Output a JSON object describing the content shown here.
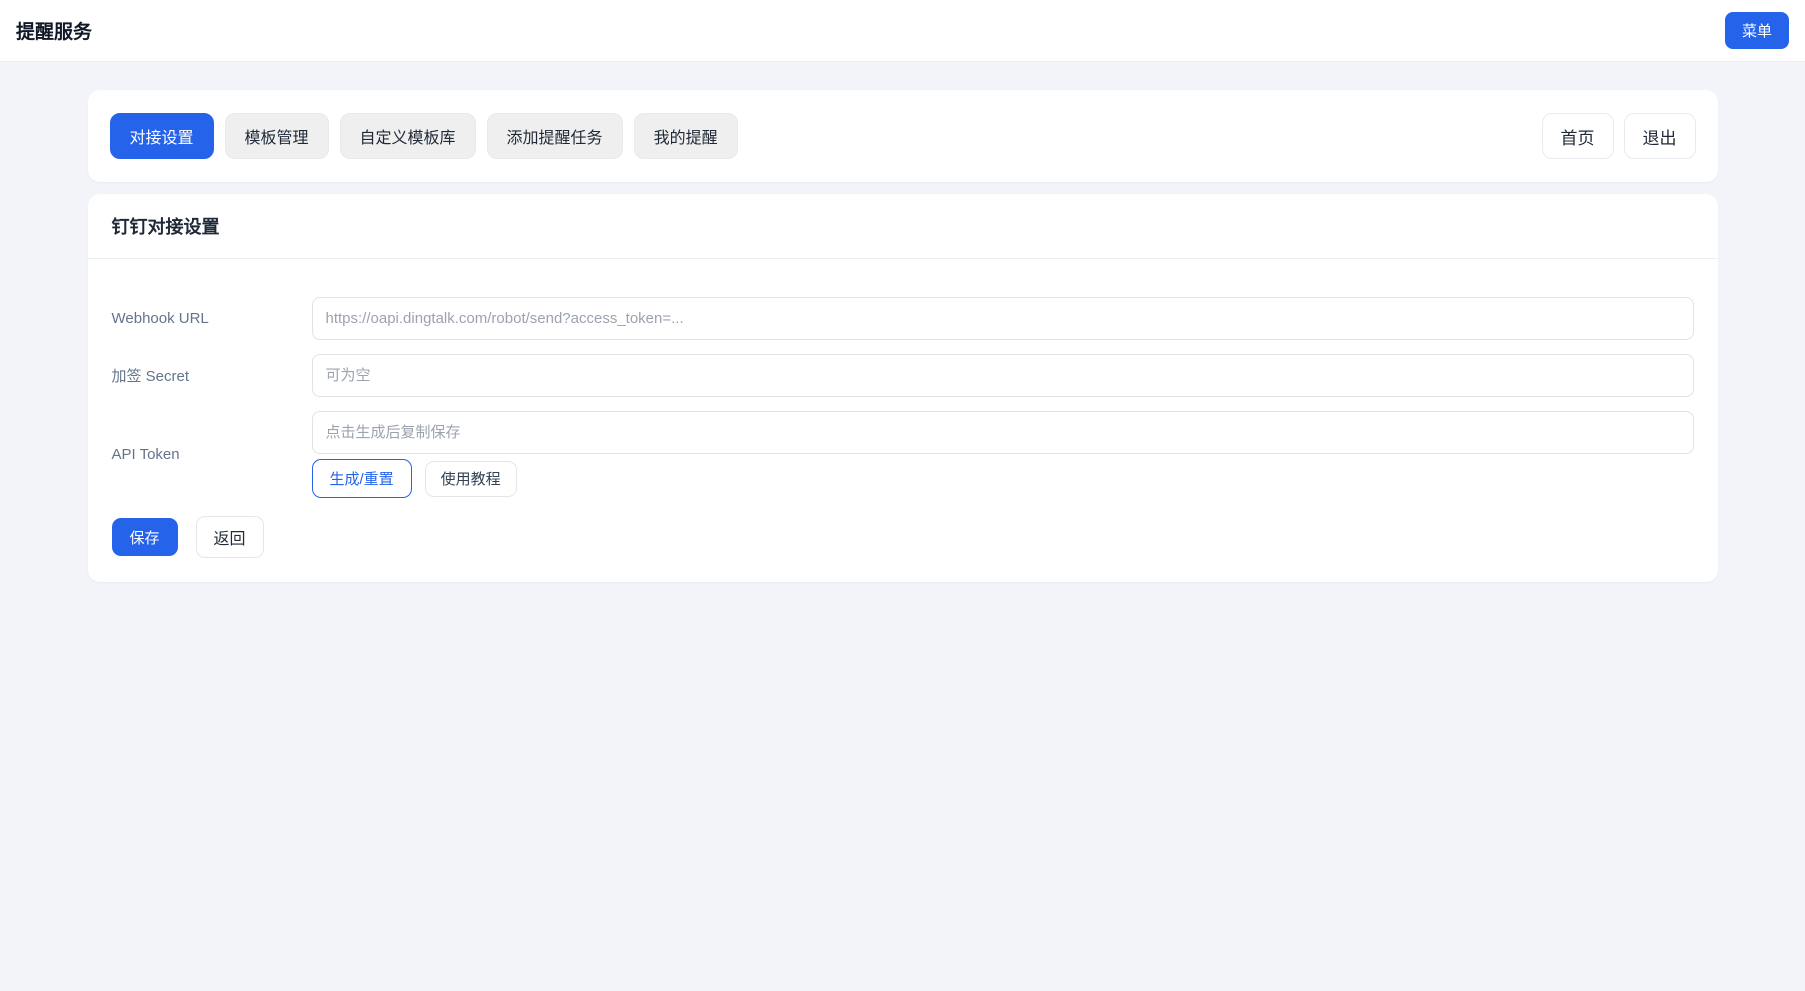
{
  "header": {
    "title": "提醒服务",
    "menu_button": "菜单"
  },
  "nav": {
    "tabs": [
      {
        "label": "对接设置",
        "active": true
      },
      {
        "label": "模板管理",
        "active": false
      },
      {
        "label": "自定义模板库",
        "active": false
      },
      {
        "label": "添加提醒任务",
        "active": false
      },
      {
        "label": "我的提醒",
        "active": false
      }
    ],
    "home_button": "首页",
    "logout_button": "退出"
  },
  "settings_card": {
    "title": "钉钉对接设置",
    "fields": {
      "webhook": {
        "label": "Webhook URL",
        "value": "",
        "placeholder": "https://oapi.dingtalk.com/robot/send?access_token=..."
      },
      "secret": {
        "label": "加签 Secret",
        "value": "",
        "placeholder": "可为空"
      },
      "token": {
        "label": "API Token",
        "value": "",
        "placeholder": "点击生成后复制保存"
      }
    },
    "token_buttons": {
      "generate": "生成/重置",
      "tutorial": "使用教程"
    },
    "actions": {
      "save": "保存",
      "back": "返回"
    }
  },
  "colors": {
    "accent": "#2563eb",
    "page_background": "#f2f4f9",
    "card_background": "#ffffff"
  }
}
